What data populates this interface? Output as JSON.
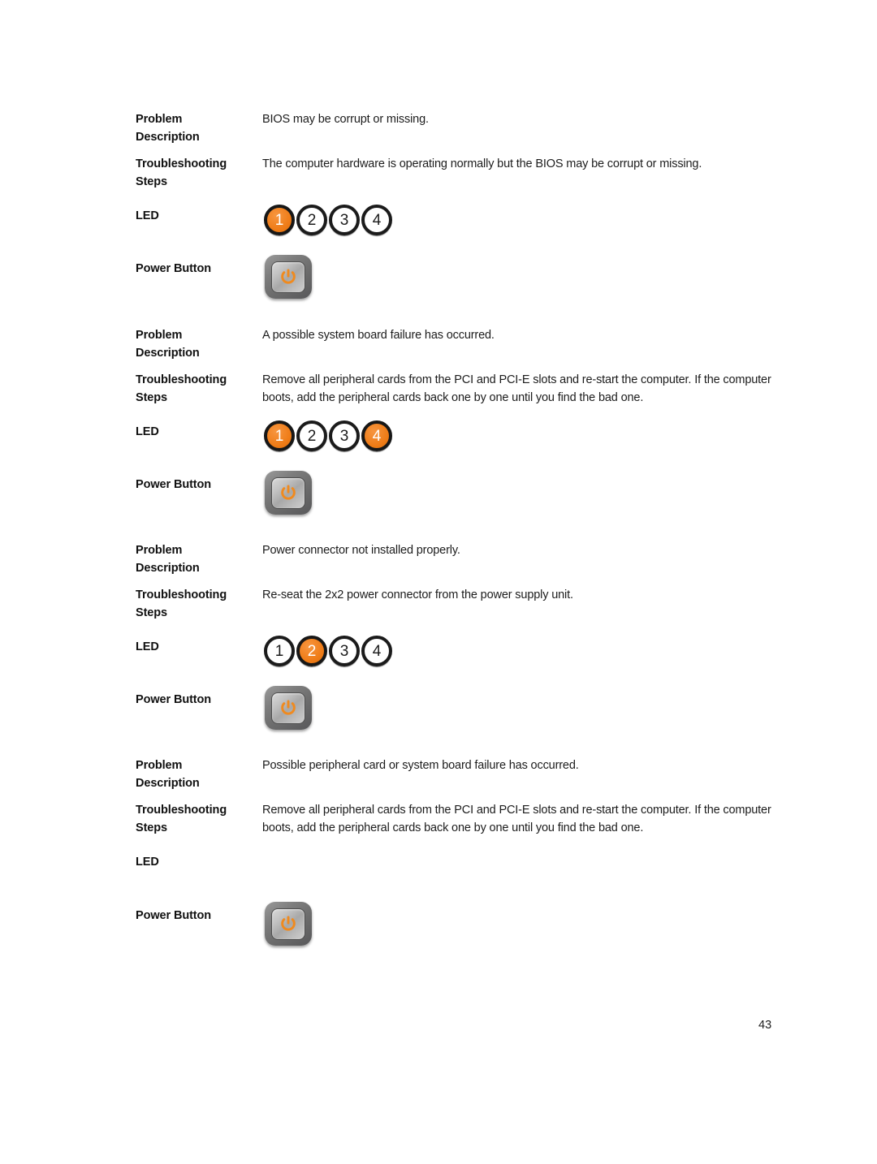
{
  "document": {
    "page_number": "43",
    "accent_color": "#ef7c17",
    "text_color": "#1c1c1c"
  },
  "labels": {
    "problem_description": "Problem\nDescription",
    "troubleshooting_steps": "Troubleshooting\nSteps",
    "led": "LED",
    "power_button": "Power Button"
  },
  "entries": [
    {
      "problem_description": "BIOS may be corrupt or missing.",
      "troubleshooting_steps": "The computer hardware is operating normally but the BIOS may be corrupt or missing.",
      "led": {
        "present": true,
        "lights": [
          {
            "number": "1",
            "state": "on"
          },
          {
            "number": "2",
            "state": "off"
          },
          {
            "number": "3",
            "state": "off"
          },
          {
            "number": "4",
            "state": "off"
          }
        ]
      },
      "power_button": {
        "present": true,
        "state": "amber"
      }
    },
    {
      "problem_description": "A possible system board failure has occurred.",
      "troubleshooting_steps": "Remove all peripheral cards from the PCI and PCI-E slots and re-start the computer. If the computer boots, add the peripheral cards back one by one until you find the bad one.",
      "led": {
        "present": true,
        "lights": [
          {
            "number": "1",
            "state": "on"
          },
          {
            "number": "2",
            "state": "off"
          },
          {
            "number": "3",
            "state": "off"
          },
          {
            "number": "4",
            "state": "on"
          }
        ]
      },
      "power_button": {
        "present": true,
        "state": "amber"
      }
    },
    {
      "problem_description": "Power connector not installed properly.",
      "troubleshooting_steps": "Re-seat the 2x2 power connector from the power supply unit.",
      "led": {
        "present": true,
        "lights": [
          {
            "number": "1",
            "state": "off"
          },
          {
            "number": "2",
            "state": "on"
          },
          {
            "number": "3",
            "state": "off"
          },
          {
            "number": "4",
            "state": "off"
          }
        ]
      },
      "power_button": {
        "present": true,
        "state": "amber"
      }
    },
    {
      "problem_description": "Possible peripheral card or system board failure has occurred.",
      "troubleshooting_steps": "Remove all peripheral cards from the PCI and PCI-E slots and re-start the computer. If the computer boots, add the peripheral cards back one by one until you find the bad one.",
      "led": {
        "present": false,
        "lights": []
      },
      "power_button": {
        "present": true,
        "state": "amber"
      }
    }
  ],
  "icons": {
    "power_symbol": "power-icon"
  }
}
